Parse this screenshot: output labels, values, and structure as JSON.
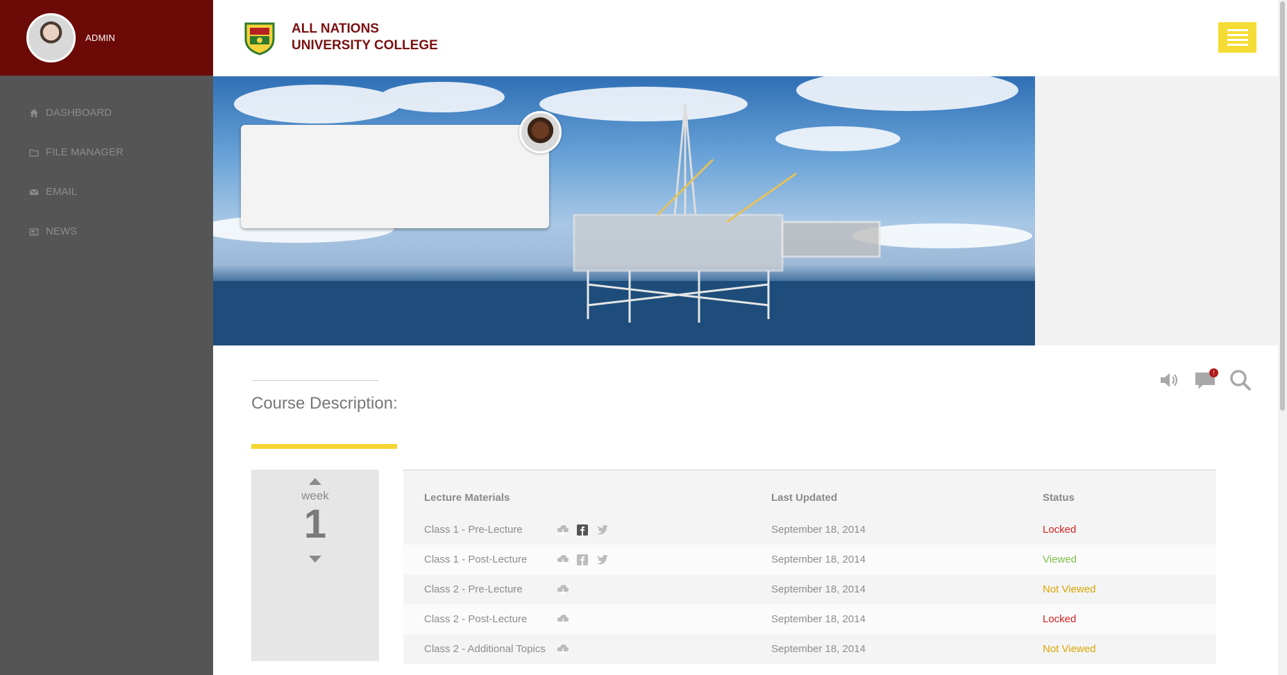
{
  "sidebar": {
    "admin_name": "ADMIN",
    "items": [
      {
        "label": "DASHBOARD",
        "icon": "home-icon"
      },
      {
        "label": "FILE MANAGER",
        "icon": "folder-icon"
      },
      {
        "label": "EMAIL",
        "icon": "envelope-icon"
      },
      {
        "label": "NEWS",
        "icon": "newspaper-icon"
      }
    ]
  },
  "header": {
    "logo_line1": "ALL NATIONS",
    "logo_line2": "UNIVERSITY COLLEGE",
    "menu_icon": "hamburger-icon"
  },
  "course": {
    "description_title": "Course Description:"
  },
  "toolbar": {
    "notification_count": "!"
  },
  "week": {
    "label": "week",
    "number": "1"
  },
  "table": {
    "headers": {
      "materials": "Lecture Materials",
      "updated": "Last Updated",
      "status": "Status"
    },
    "rows": [
      {
        "name": "Class 1 - Pre-Lecture",
        "updated": "September 18, 2014",
        "status": "Locked"
      },
      {
        "name": "Class 1 - Post-Lecture",
        "updated": "September 18, 2014",
        "status": "Viewed"
      },
      {
        "name": "Class 2 - Pre-Lecture",
        "updated": "September 18, 2014",
        "status": "Not Viewed"
      },
      {
        "name": "Class 2 - Post-Lecture",
        "updated": "September 18, 2014",
        "status": "Locked"
      },
      {
        "name": "Class 2 - Additional Topics",
        "updated": "September 18, 2014",
        "status": "Not Viewed"
      }
    ]
  },
  "colors": {
    "sidebar_top": "#6b0a07",
    "sidebar": "#555555",
    "accent_yellow": "#f5d533",
    "locked": "#d62020",
    "viewed": "#7cbf4a",
    "not_viewed": "#d9a500"
  }
}
